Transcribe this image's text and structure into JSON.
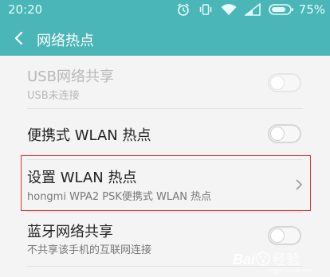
{
  "status_bar": {
    "time": "20:20",
    "battery_percent": "75%",
    "icons": [
      "alarm-icon",
      "vibrate-icon",
      "wifi-icon",
      "signal-icon",
      "battery-icon"
    ]
  },
  "titlebar": {
    "title": "网络热点",
    "back_icon": "chevron-left-icon"
  },
  "items": [
    {
      "title": "USB网络共享",
      "subtitle": "USB未连接",
      "control": "toggle",
      "enabled": false,
      "checked": false
    },
    {
      "title": "便携式 WLAN 热点",
      "subtitle": "",
      "control": "toggle",
      "enabled": true,
      "checked": false
    },
    {
      "title": "设置 WLAN 热点",
      "subtitle": "hongmi WPA2 PSK便携式 WLAN 热点",
      "control": "chevron",
      "enabled": true
    },
    {
      "title": "蓝牙网络共享",
      "subtitle": "不共享该手机的互联网连接",
      "control": "toggle",
      "enabled": true,
      "checked": false
    }
  ],
  "colors": {
    "header": "#4ab6b8",
    "background": "#f4f4f4",
    "highlight": "#e03434"
  },
  "watermark": {
    "logo": "baidu-paw-logo",
    "text": "Baidu 经验",
    "subtext": "jingyan.baidu.com"
  }
}
